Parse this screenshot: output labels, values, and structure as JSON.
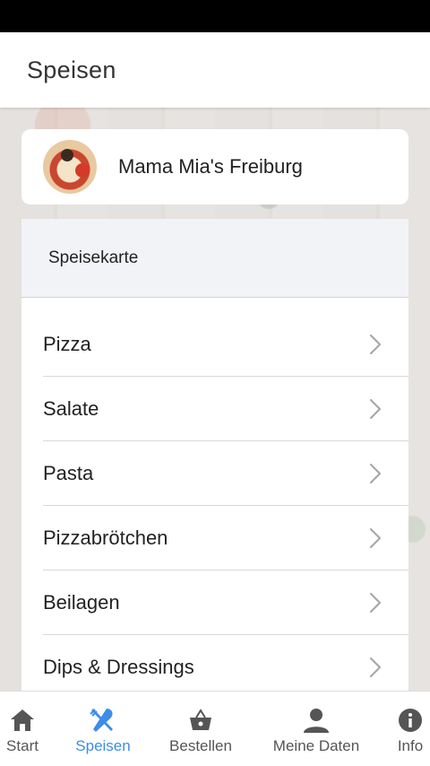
{
  "app_bar": {
    "title": "Speisen"
  },
  "restaurant": {
    "name": "Mama Mia's Freiburg"
  },
  "menu": {
    "header": "Speisekarte",
    "items": [
      {
        "label": "Pizza"
      },
      {
        "label": "Salate"
      },
      {
        "label": "Pasta"
      },
      {
        "label": "Pizzabrötchen"
      },
      {
        "label": "Beilagen"
      },
      {
        "label": "Dips & Dressings"
      }
    ]
  },
  "bottom_nav": {
    "items": [
      {
        "label": "Start",
        "icon": "home-icon"
      },
      {
        "label": "Speisen",
        "icon": "cutlery-icon",
        "active": true
      },
      {
        "label": "Bestellen",
        "icon": "basket-icon"
      },
      {
        "label": "Meine Daten",
        "icon": "person-icon"
      },
      {
        "label": "Info",
        "icon": "info-icon"
      }
    ]
  },
  "colors": {
    "accent": "#3b8de8",
    "inactive": "#555555",
    "header_bg": "#f2f3f7"
  }
}
